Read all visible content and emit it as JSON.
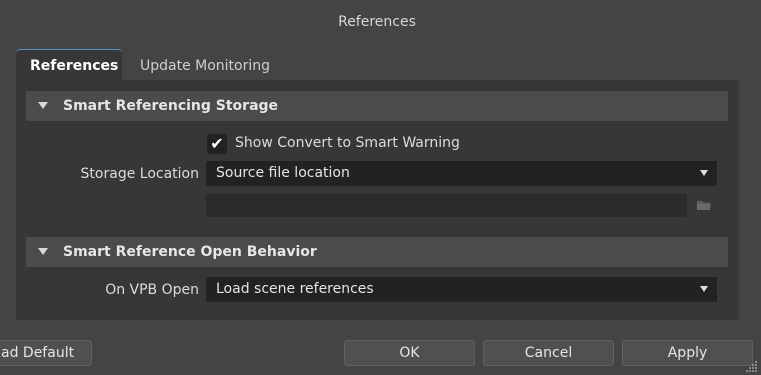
{
  "window": {
    "title": "References"
  },
  "tabs": [
    {
      "label": "References",
      "active": true
    },
    {
      "label": "Update Monitoring",
      "active": false
    }
  ],
  "sections": [
    {
      "title": "Smart Referencing Storage",
      "expanded": true,
      "checkbox": {
        "label": "Show Convert to Smart Warning",
        "checked": true
      },
      "storage_location": {
        "label": "Storage Location",
        "value": "Source file location",
        "path_value": ""
      }
    },
    {
      "title": "Smart Reference Open Behavior",
      "expanded": true,
      "on_vpb_open": {
        "label": "On VPB Open",
        "value": "Load scene references"
      }
    }
  ],
  "buttons": {
    "load_default": "ad Default",
    "ok": "OK",
    "cancel": "Cancel",
    "apply": "Apply"
  },
  "colors": {
    "background": "#444444",
    "panel": "#373737",
    "section_header": "#4b4b4b",
    "field": "#222222",
    "tab_accent": "#5a8fbf"
  },
  "icons": [
    "collapse-triangle-icon",
    "checkmark-icon",
    "dropdown-arrow-icon",
    "folder-icon",
    "resize-grip-icon"
  ]
}
